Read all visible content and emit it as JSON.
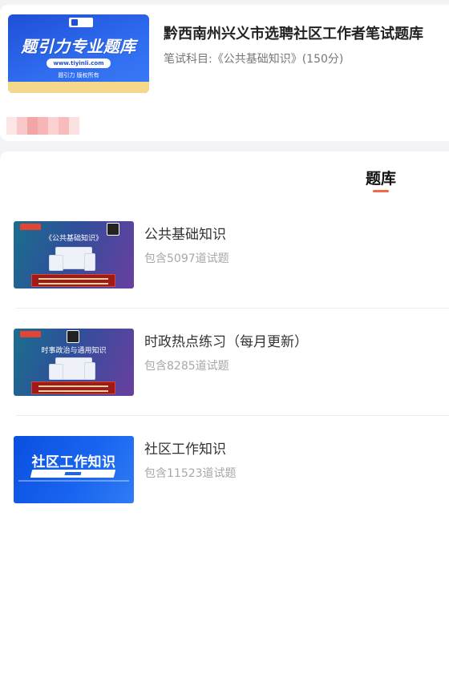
{
  "header": {
    "cover_title": "题引力专业题库",
    "cover_url": "www.tiyinli.com",
    "cover_rights": "题引力 版权所有",
    "exam_title": "黔西南州兴义市选聘社区工作者笔试题库",
    "exam_subject": "笔试科目:《公共基础知识》(150分)"
  },
  "blur_colors": [
    "#fde6e6",
    "#f9c8c8",
    "#f4a6a6",
    "#f7b5b5",
    "#fbd2d2",
    "#f8bcbc",
    "#fbe0e0"
  ],
  "tab": {
    "label": "题库",
    "accent_color": "#f06a4a"
  },
  "banks": [
    {
      "title": "公共基础知识",
      "count": "包含5097道试题",
      "thumb_heading": "《公共基础知识》",
      "thumb_style": "purple"
    },
    {
      "title": "时政热点练习（每月更新）",
      "count": "包含8285道试题",
      "thumb_heading": "时事政治与通用知识",
      "thumb_style": "purple"
    },
    {
      "title": "社区工作知识",
      "count": "包含11523道试题",
      "thumb_heading": "社区工作知识",
      "thumb_style": "blue"
    }
  ]
}
